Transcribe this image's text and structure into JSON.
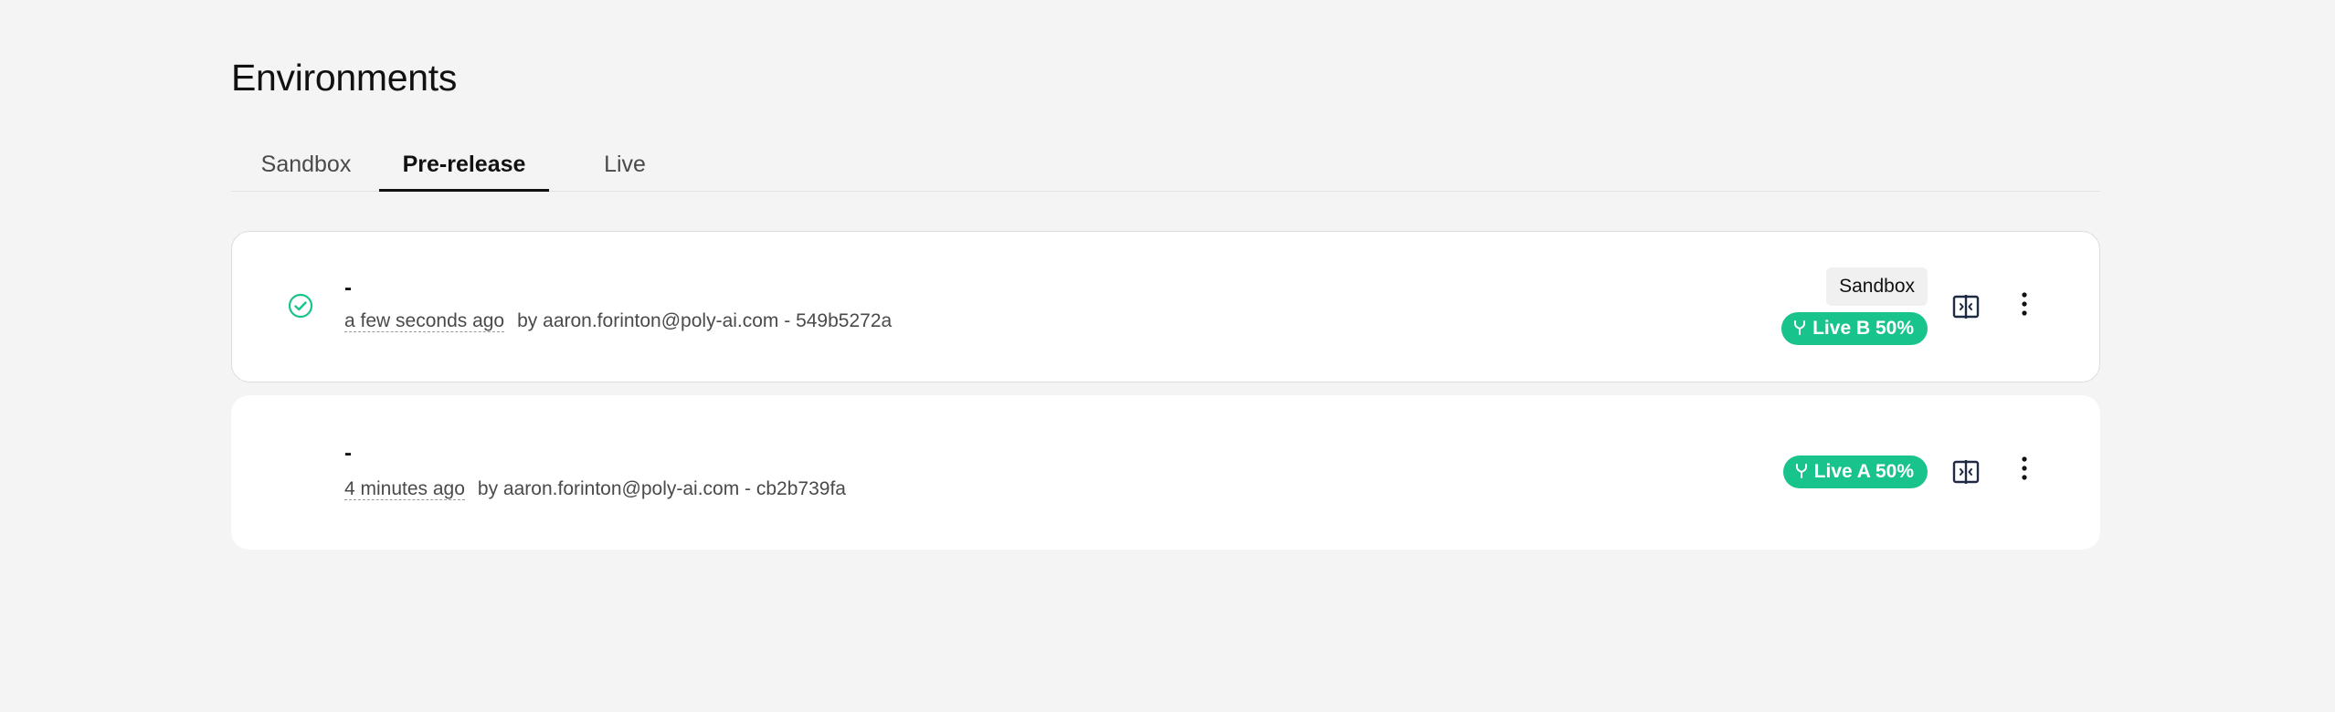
{
  "page": {
    "title": "Environments"
  },
  "tabs": [
    {
      "label": "Sandbox",
      "active": false
    },
    {
      "label": "Pre-release",
      "active": true
    },
    {
      "label": "Live",
      "active": false
    }
  ],
  "versions": [
    {
      "name": "-",
      "time_ago": "a few seconds ago",
      "details": "by aaron.forinton@poly-ai.com - 549b5272a",
      "status_icon": "check-circle-icon",
      "environment_badge": "Sandbox",
      "live_badge": "Live B 50%"
    },
    {
      "name": "-",
      "time_ago": "4 minutes ago",
      "details": "by aaron.forinton@poly-ai.com - cb2b739fa",
      "live_badge": "Live A 50%"
    }
  ],
  "icons": {
    "compare": "compare-columns-icon",
    "more": "more-vertical-icon",
    "branch": "branch-icon"
  },
  "colors": {
    "background": "#f4f4f4",
    "card": "#ffffff",
    "accent_green": "#19c38c",
    "text_primary": "#111111",
    "text_secondary": "#4a4a4a"
  }
}
